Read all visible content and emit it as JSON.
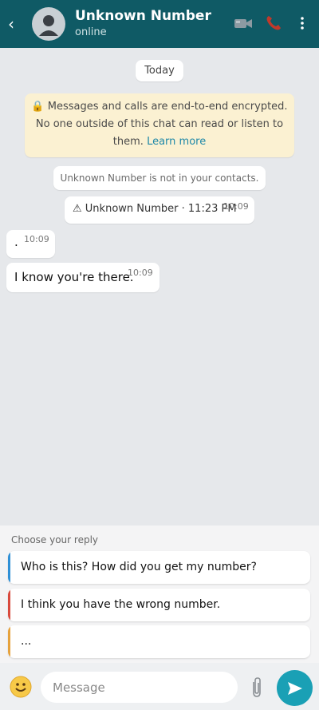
{
  "header": {
    "back_icon": "‹",
    "contact_name": "Unknown Number",
    "status": "online",
    "icons": [
      "back-icon",
      "avatar-icon",
      "video-call-icon",
      "phone-icon",
      "more-vert-icon"
    ]
  },
  "chat": {
    "date_label": "Today",
    "encryption": {
      "text": "Messages and calls are end-to-end encrypted. No one outside of this chat can read or listen to them.",
      "link": "Learn more"
    },
    "not_in_contacts": "Unknown Number is not in your contacts.",
    "system_message": {
      "text": "Unknown Number · 11:23 PM",
      "time": "10:09"
    },
    "messages": [
      {
        "text": ".",
        "time": "10:09"
      },
      {
        "text": "I know you're there.",
        "time": "10:09"
      }
    ]
  },
  "reply_panel": {
    "label": "Choose your reply",
    "options": [
      {
        "text": "Who is this? How did you get my number?",
        "accent": "#2f90d6"
      },
      {
        "text": "I think you have the wrong number.",
        "accent": "#d94a3d"
      },
      {
        "text": "...",
        "accent": "#e6a23c"
      }
    ]
  },
  "input_bar": {
    "placeholder": "Message",
    "icons": [
      "emoji-icon",
      "paperclip-icon",
      "send-icon"
    ]
  },
  "colors": {
    "header": "#0f5a65",
    "chat_bg": "#e6e8eb",
    "encryption_bg": "#fbf1d2",
    "link": "#1e88a8",
    "send": "#1aa0b5"
  }
}
